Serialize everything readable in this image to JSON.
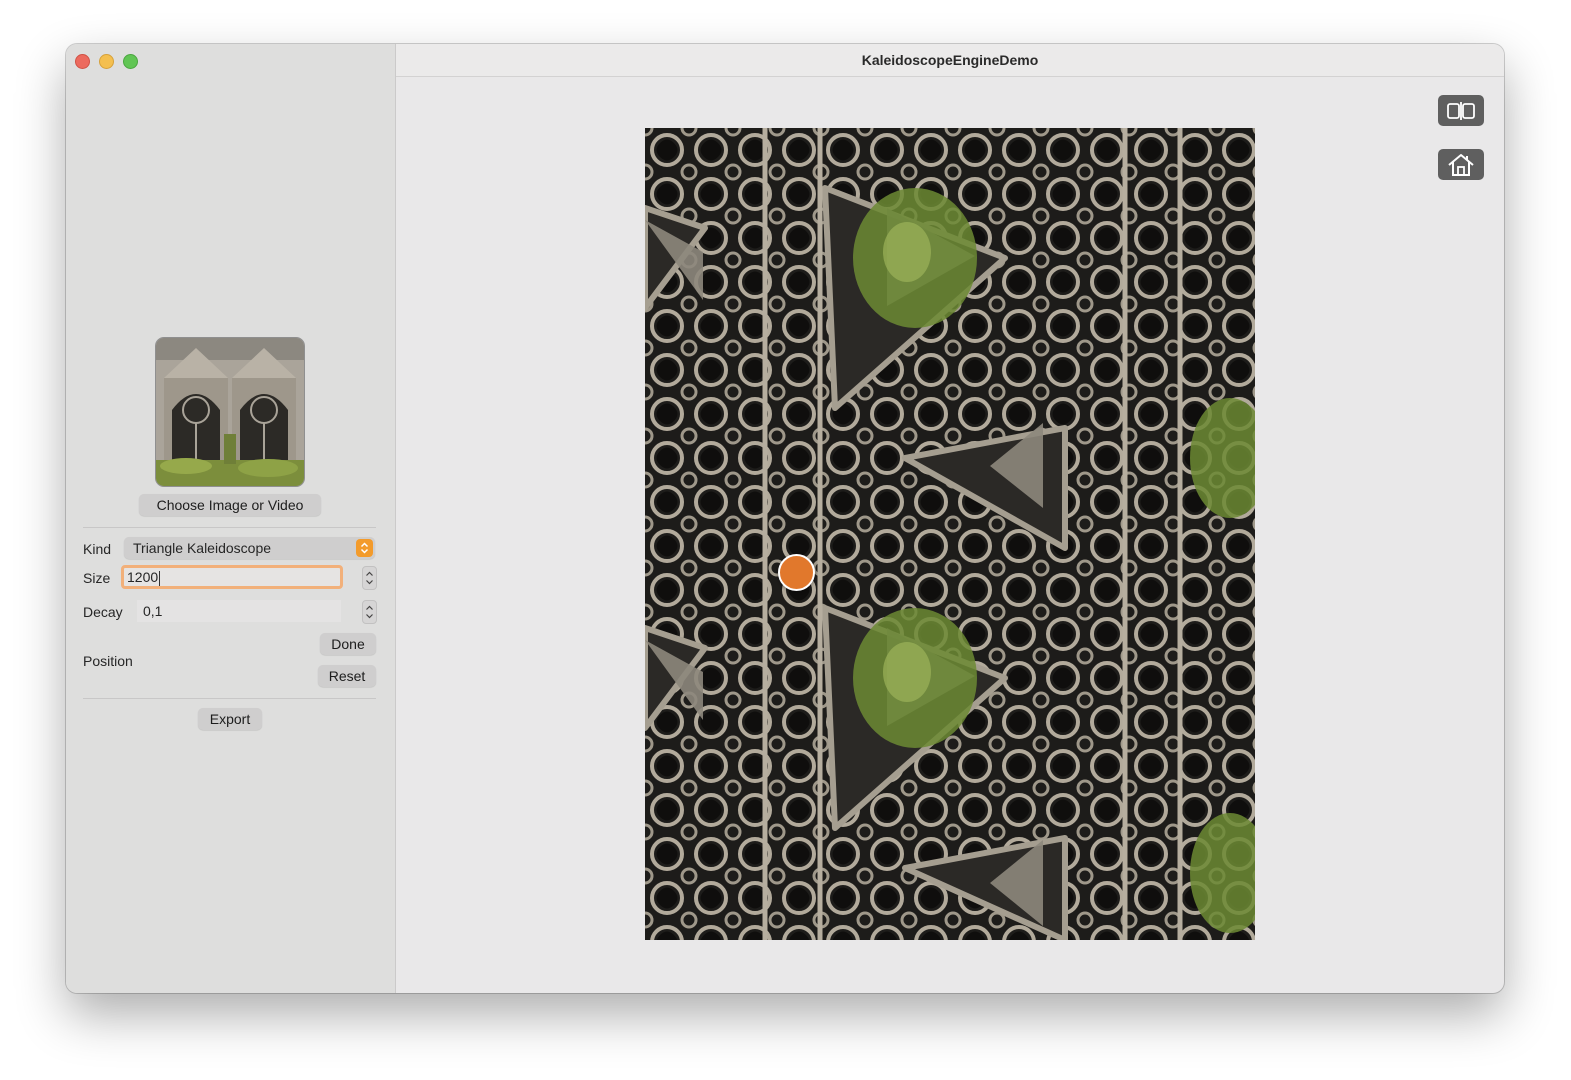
{
  "window": {
    "title": "KaleidoscopeEngineDemo"
  },
  "sidebar": {
    "choose_button": "Choose Image or Video",
    "kind": {
      "label": "Kind",
      "value": "Triangle Kaleidoscope"
    },
    "size": {
      "label": "Size",
      "value": "1200"
    },
    "decay": {
      "label": "Decay",
      "value": "0,1"
    },
    "position": {
      "label": "Position",
      "done_button": "Done",
      "reset_button": "Reset"
    },
    "export_button": "Export"
  },
  "toolbar": {
    "icons": [
      "split-view-icon",
      "home-icon"
    ]
  },
  "colors": {
    "accent": "#f39b2b",
    "handle": "#e1782c",
    "sidebar": "#dededd",
    "content": "#e9e8e9"
  }
}
